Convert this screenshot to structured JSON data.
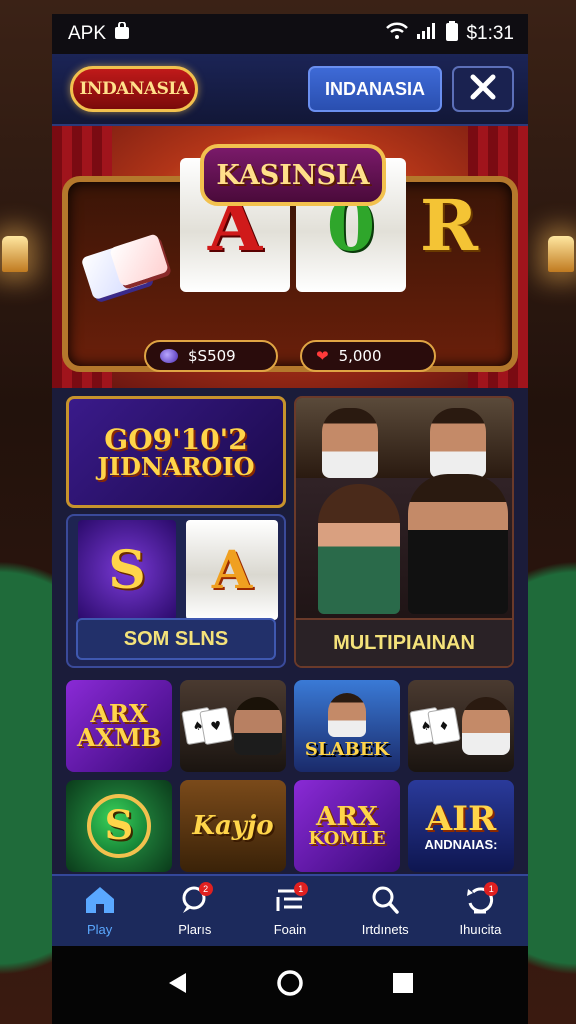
{
  "status_bar": {
    "left_label": "APK",
    "time": "$1:31"
  },
  "header": {
    "logo_text": "INDANASIA",
    "brand_button": "INDANASIA",
    "close_icon": "close-icon"
  },
  "hero": {
    "marquee": "KASINSIA",
    "reels": [
      "A",
      "0",
      "R"
    ],
    "counters": [
      {
        "icon": "chip-icon",
        "value": "$S509"
      },
      {
        "icon": "heart-icon",
        "value": "5,000"
      }
    ]
  },
  "featured": {
    "banner_line1": "GO9'10'2",
    "banner_line2": "JIDNAROIO",
    "slots_reels": [
      "S",
      "A"
    ],
    "slots_label": "SOM SLNS",
    "multiplayer_label": "MULTIPIAINAN"
  },
  "tiles": [
    {
      "type": "text",
      "line1": "ARX",
      "line2": "AXMB"
    },
    {
      "type": "person"
    },
    {
      "type": "text",
      "line1": "SLABEK",
      "line2": ""
    },
    {
      "type": "person"
    },
    {
      "type": "coin",
      "line1": "S"
    },
    {
      "type": "text",
      "line1": "Kayjo",
      "line2": ""
    },
    {
      "type": "text",
      "line1": "ARX",
      "line2": "KOMLE"
    },
    {
      "type": "text",
      "line1": "AIR",
      "line2": "ANDNAIAS:"
    }
  ],
  "nav": [
    {
      "label": "Play",
      "icon": "home-icon",
      "badge": ""
    },
    {
      "label": "Plarıs",
      "icon": "chat-icon",
      "badge": "2"
    },
    {
      "label": "Foain",
      "icon": "list-icon",
      "badge": "1"
    },
    {
      "label": "Irtdınets",
      "icon": "search-icon",
      "badge": ""
    },
    {
      "label": "Ihuıcita",
      "icon": "refresh-icon",
      "badge": "1"
    }
  ],
  "colors": {
    "accent": "#5aa8ff",
    "gold": "#f2c14e",
    "nav_bg": "#1c2a5c"
  }
}
